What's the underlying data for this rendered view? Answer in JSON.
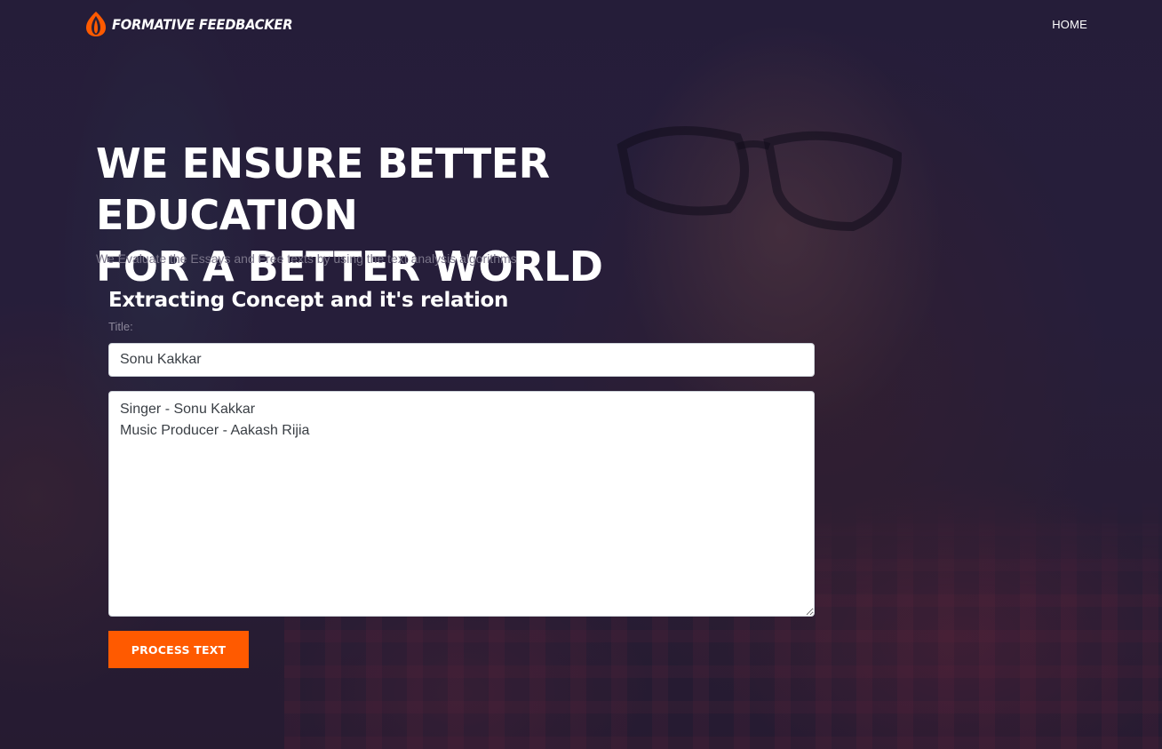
{
  "header": {
    "brand": "FORMATIVE FEEDBACKER",
    "logo_icon": "flame-drop-icon",
    "nav": [
      {
        "label": "HOME"
      }
    ]
  },
  "hero": {
    "title_line1": "WE ENSURE BETTER EDUCATION",
    "title_line2": "FOR A BETTER WORLD",
    "subtitle": "We Evaluate the Essays and Free texts by using the text analysis algorithms"
  },
  "form": {
    "heading": "Extracting Concept and it's relation",
    "title_label": "Title:",
    "title_value": "Sonu Kakkar",
    "body_value": "Singer - Sonu Kakkar\nMusic Producer - Aakash Rijia",
    "submit_label": "PROCESS TEXT"
  },
  "colors": {
    "accent": "#ff5a00",
    "overlay": "#2a2138",
    "text_light": "#ffffff",
    "subtitle": "#7a7589"
  }
}
